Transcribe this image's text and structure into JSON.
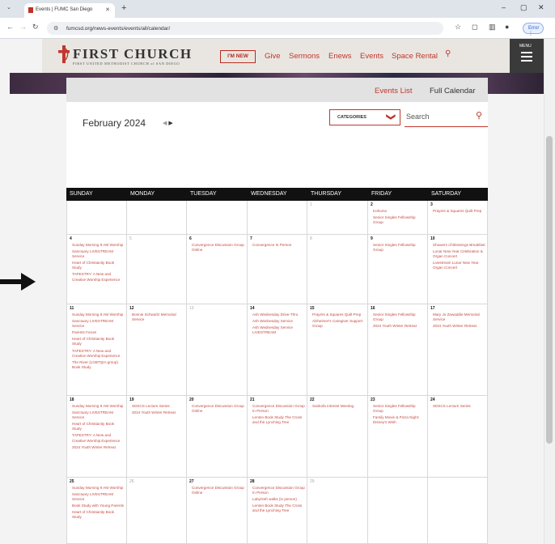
{
  "browser": {
    "tab_title": "Events | FUMC San Diego",
    "url": "fumcsd.org/news-events/events/all/calendar/",
    "error_label": "Error"
  },
  "site": {
    "logo_title": "FIRST CHURCH",
    "logo_subtitle": "FIRST UNITED METHODIST CHURCH of SAN DIEGO",
    "im_new": "I'M NEW",
    "nav": [
      "Give",
      "Sermons",
      "Enews",
      "Events",
      "Space Rental"
    ],
    "menu_label": "MENU",
    "accent_color": "#c0372e"
  },
  "calendar": {
    "views": {
      "events_list": "Events List",
      "full_calendar": "Full Calendar"
    },
    "month_label": "February 2024",
    "categories_label": "CATEGORIES",
    "search_placeholder": "Search",
    "day_names": [
      "SUNDAY",
      "MONDAY",
      "TUESDAY",
      "WEDNESDAY",
      "THURSDAY",
      "FRIDAY",
      "SATURDAY"
    ],
    "weeks": [
      [
        {
          "day": "",
          "events": []
        },
        {
          "day": "",
          "events": []
        },
        {
          "day": "",
          "events": []
        },
        {
          "day": "",
          "events": []
        },
        {
          "day": "1",
          "events": []
        },
        {
          "day": "2",
          "events": [
            "Kohomo",
            "Senior Singles Fellowship Group"
          ]
        },
        {
          "day": "3",
          "events": [
            "Prayers & Squares Quilt Prep"
          ]
        }
      ],
      [
        {
          "day": "4",
          "events": [
            "Sunday Morning 9 AM Worship",
            "Sanctuary LIVESTREAM Service",
            "Heart of Christianity Book Study",
            "TAPESTRY: A New and Creative Worship Experience"
          ]
        },
        {
          "day": "5",
          "events": []
        },
        {
          "day": "6",
          "events": [
            "Convergence Discussion Group Online"
          ]
        },
        {
          "day": "7",
          "events": [
            "Convergence In Person"
          ]
        },
        {
          "day": "8",
          "events": []
        },
        {
          "day": "9",
          "events": [
            "Senior Singles Fellowship Group"
          ]
        },
        {
          "day": "10",
          "events": [
            "Showers of Blessings Breakfast",
            "Lunar New Year Celebration & Organ Concert",
            "Livestream Lunar New Year Organ Concert"
          ]
        }
      ],
      [
        {
          "day": "11",
          "events": [
            "Sunday Morning 9 AM Worship",
            "Sanctuary LIVESTREAM Service",
            "Parents Forum",
            "Heart of Christianity Book Study",
            "TAPESTRY: A New and Creative Worship Experience",
            "The River (LGBTQIA group) Book Study"
          ]
        },
        {
          "day": "12",
          "events": [
            "Bonnie Schwartz Memorial Service"
          ]
        },
        {
          "day": "13",
          "events": []
        },
        {
          "day": "14",
          "events": [
            "Ash Wednesday Drive-Thru",
            "Ash Wednesday Service",
            "Ash Wednesday Service LIVESTREAM"
          ]
        },
        {
          "day": "15",
          "events": [
            "Prayers & Squares Quilt Prep",
            "Alzheimer's Caregiver Support Group"
          ]
        },
        {
          "day": "16",
          "events": [
            "Senior Singles Fellowship Group",
            "2024 Youth Winter Retreat"
          ]
        },
        {
          "day": "17",
          "events": [
            "Mary Jo Zawaddie Memorial Service",
            "2024 Youth Winter Retreat"
          ]
        }
      ],
      [
        {
          "day": "18",
          "events": [
            "Sunday Morning 9 AM Worship",
            "Sanctuary LIVESTREAM Service",
            "Heart of Christianity Book Study",
            "TAPESTRY: A New and Creative Worship Experience",
            "2024 Youth Winter Retreat"
          ]
        },
        {
          "day": "19",
          "events": [
            "SDSCS Lecture Series",
            "2024 Youth Winter Retreat"
          ]
        },
        {
          "day": "20",
          "events": [
            "Convergence Discussion Group Online"
          ]
        },
        {
          "day": "21",
          "events": [
            "Convergence Discussion Group In Person",
            "Lenten Book Study The Cross and the Lynching Tree"
          ]
        },
        {
          "day": "22",
          "events": [
            "Sankofa Interest Meeting"
          ]
        },
        {
          "day": "23",
          "events": [
            "Senior Singles Fellowship Group",
            "Family Movie & Pizza Night: Disney's Wish"
          ]
        },
        {
          "day": "24",
          "events": [
            "SDSCS Lecture Series"
          ]
        }
      ],
      [
        {
          "day": "25",
          "events": [
            "Sunday Morning 9 AM Worship",
            "Sanctuary LIVESTREAM Service",
            "Book Study with Young Parents",
            "Heart of Christianity Book Study"
          ]
        },
        {
          "day": "26",
          "events": []
        },
        {
          "day": "27",
          "events": [
            "Convergence Discussion Group Online"
          ]
        },
        {
          "day": "28",
          "events": [
            "Convergence Discussion Group In Person",
            "Labyrinth walks (in person)",
            "Lenten Book Study The Cross and the Lynching Tree"
          ]
        },
        {
          "day": "29",
          "events": []
        },
        {
          "day": "",
          "events": []
        },
        {
          "day": "",
          "events": []
        }
      ]
    ]
  }
}
